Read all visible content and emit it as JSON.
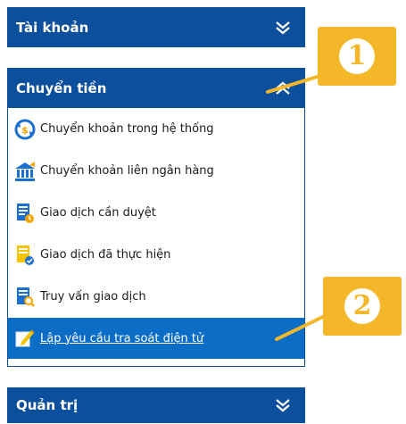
{
  "accounts_panel": {
    "title": "Tài khoản",
    "toggle_icon": "double-chevron-down-icon"
  },
  "transfer_panel": {
    "title": "Chuyển tiền",
    "toggle_icon": "double-chevron-up-icon",
    "items": [
      {
        "label": "Chuyển khoản trong hệ thống",
        "icon": "internal-transfer-icon"
      },
      {
        "label": "Chuyển khoản liên ngân hàng",
        "icon": "bank-icon"
      },
      {
        "label": "Giao dịch cần duyệt",
        "icon": "pending-approval-icon"
      },
      {
        "label": "Giao dịch đã thực hiện",
        "icon": "completed-transaction-icon"
      },
      {
        "label": "Truy vấn giao dịch",
        "icon": "transaction-search-icon"
      },
      {
        "label": "Lập yêu cầu tra soát điện tử",
        "icon": "edit-request-icon",
        "active": true
      }
    ]
  },
  "admin_panel": {
    "title": "Quản trị",
    "toggle_icon": "double-chevron-down-icon"
  },
  "callouts": [
    {
      "number": "1"
    },
    {
      "number": "2"
    }
  ],
  "colors": {
    "header": "#0c4f9c",
    "active_item": "#0c6dc7",
    "callout": "#f5b72a"
  }
}
